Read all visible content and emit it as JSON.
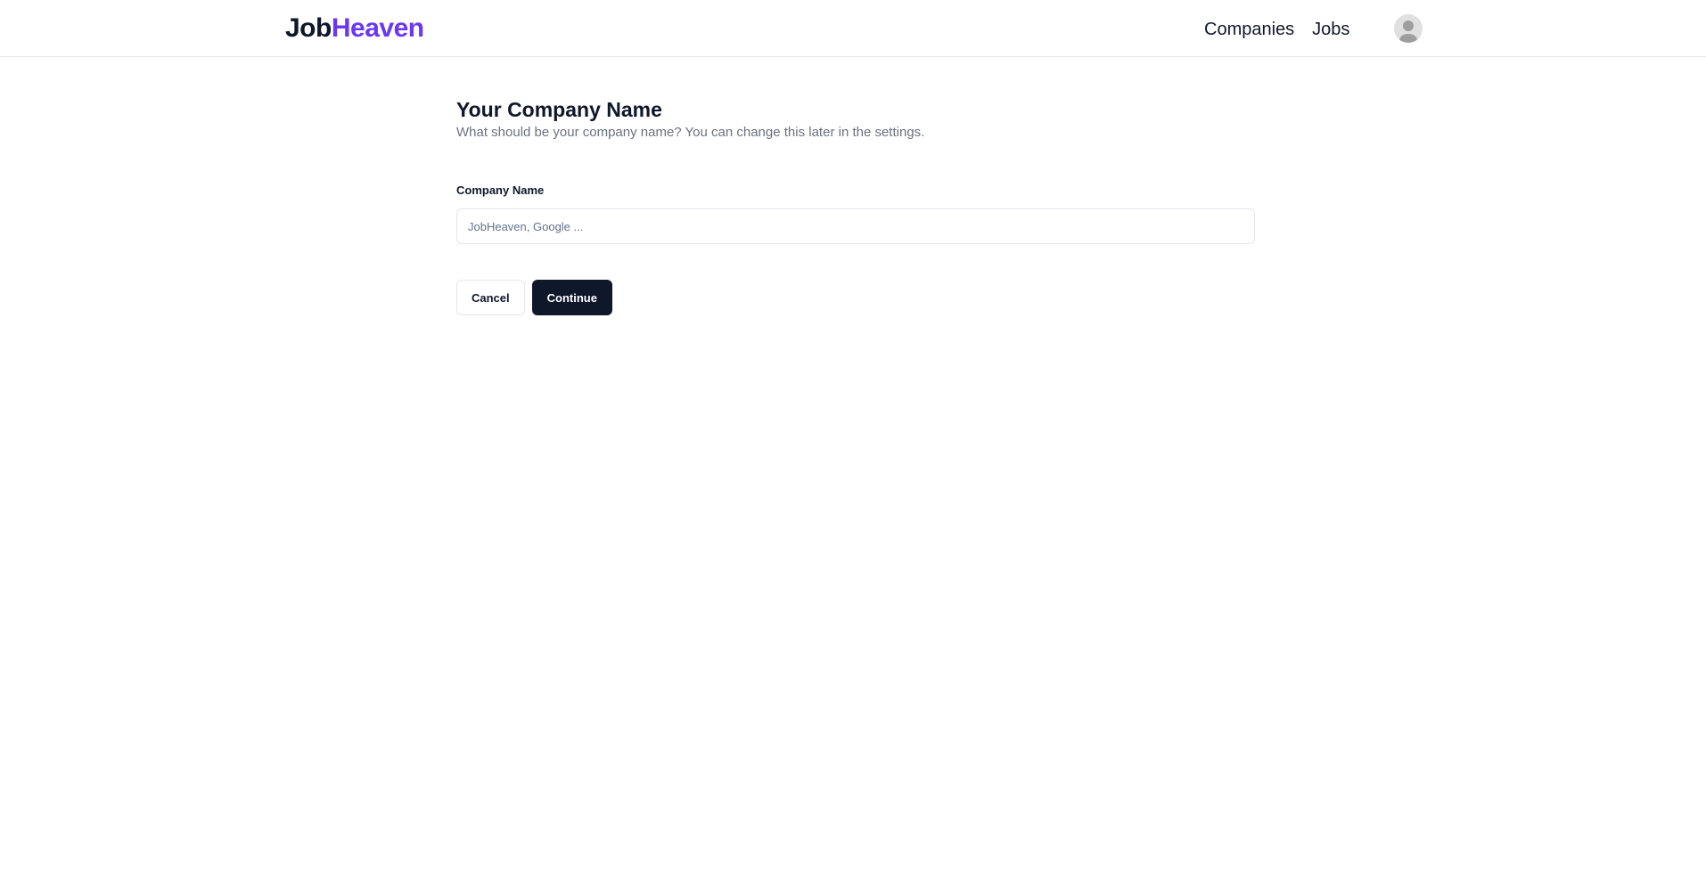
{
  "brand": {
    "part1": "Job",
    "part2": "Heaven",
    "accent_color": "#6a38f2"
  },
  "nav": {
    "links": [
      {
        "label": "Companies"
      },
      {
        "label": "Jobs"
      }
    ],
    "avatar_icon": "user-avatar-icon"
  },
  "main": {
    "title": "Your Company Name",
    "subtitle": "What should be your company name? You can change this later in the settings.",
    "field": {
      "label": "Company Name",
      "placeholder": "JobHeaven, Google ...",
      "value": ""
    },
    "buttons": {
      "cancel": "Cancel",
      "continue": "Continue"
    }
  }
}
